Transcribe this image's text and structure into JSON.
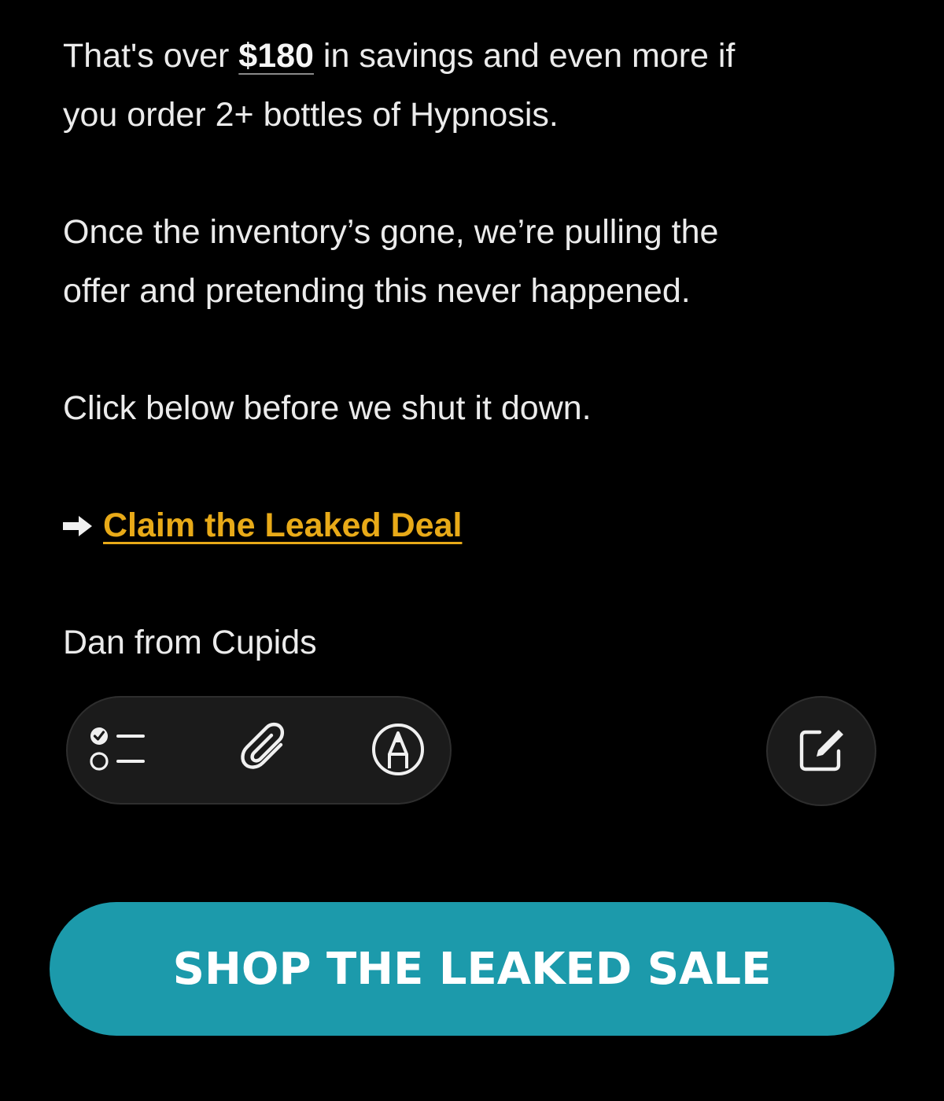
{
  "email": {
    "para1": {
      "before_amount": "That's over ",
      "amount": "$180",
      "line1_after_amount": " in savings and even more if",
      "line2": "you order 2+ bottles of Hypnosis."
    },
    "para2": {
      "line1": "Once the inventory’s gone, we’re pulling the",
      "line2": "offer and pretending this never happened."
    },
    "para3": "Click below before we shut it down.",
    "cta": {
      "arrow_icon": "right-arrow-icon",
      "link_label": "Claim the Leaked Deal"
    },
    "signature": "Dan from Cupids"
  },
  "toolbar": {
    "icons": [
      "checklist-icon",
      "paperclip-icon",
      "markup-pen-icon"
    ],
    "compose_icon": "compose-icon"
  },
  "shop_button": {
    "label": "SHOP THE LEAKED SALE"
  },
  "colors": {
    "background": "#000000",
    "text": "#ebebeb",
    "link": "#e8aa18",
    "button": "#1c9aab",
    "toolbar": "#1b1b1b"
  }
}
